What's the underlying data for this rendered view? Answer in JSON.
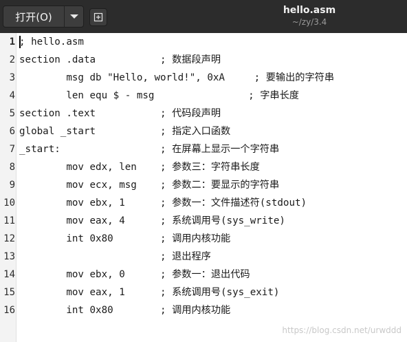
{
  "header": {
    "open_label": "打开(O)",
    "file_name": "hello.asm",
    "file_path": "~/zy/3.4"
  },
  "editor": {
    "lines": [
      {
        "num": "1",
        "text": "; hello.asm"
      },
      {
        "num": "2",
        "text": "section .data           ; 数据段声明"
      },
      {
        "num": "3",
        "text": "        msg db \"Hello, world!\", 0xA     ; 要输出的字符串"
      },
      {
        "num": "4",
        "text": "        len equ $ - msg                ; 字串长度"
      },
      {
        "num": "5",
        "text": "section .text           ; 代码段声明"
      },
      {
        "num": "6",
        "text": "global _start           ; 指定入口函数"
      },
      {
        "num": "7",
        "text": "_start:                 ; 在屏幕上显示一个字符串"
      },
      {
        "num": "8",
        "text": "        mov edx, len    ; 参数三：字符串长度"
      },
      {
        "num": "9",
        "text": "        mov ecx, msg    ; 参数二：要显示的字符串"
      },
      {
        "num": "10",
        "text": "        mov ebx, 1      ; 参数一：文件描述符(stdout)"
      },
      {
        "num": "11",
        "text": "        mov eax, 4      ; 系统调用号(sys_write)"
      },
      {
        "num": "12",
        "text": "        int 0x80        ; 调用内核功能"
      },
      {
        "num": "13",
        "text": "                        ; 退出程序"
      },
      {
        "num": "14",
        "text": "        mov ebx, 0      ; 参数一：退出代码"
      },
      {
        "num": "15",
        "text": "        mov eax, 1      ; 系统调用号(sys_exit)"
      },
      {
        "num": "16",
        "text": "        int 0x80        ; 调用内核功能"
      }
    ]
  },
  "watermark": "https://blog.csdn.net/urwddd"
}
